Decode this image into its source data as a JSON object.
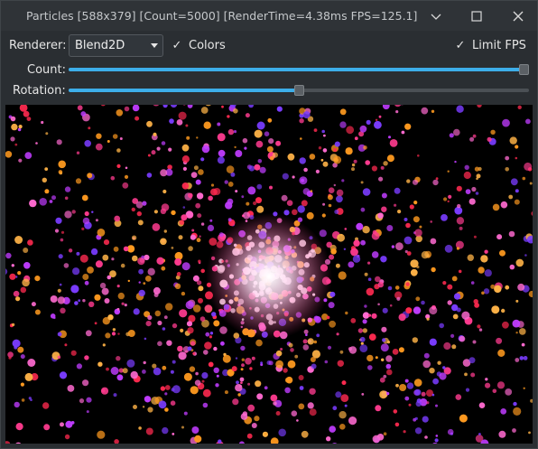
{
  "window": {
    "title": "Particles [588x379] [Count=5000] [RenderTime=4.38ms FPS=125.1]",
    "buttons": [
      "minimize",
      "maximize",
      "close"
    ]
  },
  "toolbar": {
    "renderer_label": "Renderer:",
    "renderer_value": "Blend2D",
    "colors_label": "Colors",
    "colors_checked": true,
    "limit_fps_label": "Limit FPS",
    "limit_fps_checked": true,
    "count_label": "Count:",
    "count_level": 1.0,
    "rotation_label": "Rotation:",
    "rotation_level": 0.5,
    "check_glyph": "✓"
  },
  "canvas": {
    "background": "#000000",
    "particle_colors": [
      "#ff9a1f",
      "#ff3b8f",
      "#7a3cff",
      "#ff2a50",
      "#c03cff",
      "#ffb347",
      "#ff6ad0"
    ],
    "center_color": "#ffffff"
  },
  "colors": {
    "accent": "#3daee9",
    "window_bg": "#2a2e32",
    "titlebar_bg": "#2f3337"
  }
}
